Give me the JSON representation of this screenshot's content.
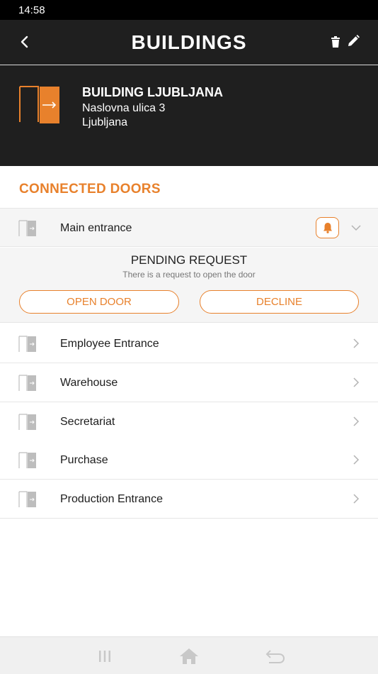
{
  "status_bar": {
    "time": "14:58"
  },
  "app_bar": {
    "title": "BUILDINGS",
    "back_icon": "chevron-left-icon",
    "trash_icon": "trash-icon",
    "edit_icon": "pencil-icon"
  },
  "building": {
    "name": "BUILDING LJUBLJANA",
    "address_line1": "Naslovna ulica 3",
    "address_line2": "Ljubljana",
    "icon": "door-enter-icon"
  },
  "section": {
    "title": "CONNECTED DOORS"
  },
  "doors": [
    {
      "label": "Main entrance",
      "expanded": true,
      "has_request": true
    },
    {
      "label": "Employee Entrance"
    },
    {
      "label": "Warehouse"
    },
    {
      "label": "Secretariat"
    },
    {
      "label": "Purchase"
    },
    {
      "label": "Production Entrance"
    }
  ],
  "pending_request": {
    "title": "PENDING REQUEST",
    "subtitle": "There is a request to open the door",
    "open_label": "OPEN DOOR",
    "decline_label": "DECLINE"
  },
  "colors": {
    "accent": "#e8812c",
    "header_bg": "#1f1f1f"
  }
}
